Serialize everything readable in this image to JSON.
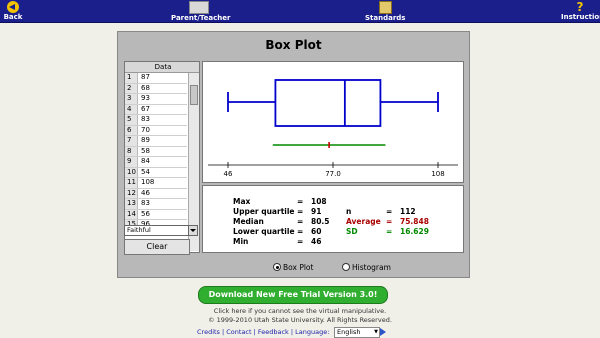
{
  "nav": {
    "back_label": "Back",
    "parent_label": "Parent/Teacher",
    "standards_label": "Standards",
    "instructions_label": "Instructions",
    "instructions_glyph": "?"
  },
  "title": "Box Plot",
  "table": {
    "header": "Data",
    "rows": [
      {
        "i": "1",
        "v": "87"
      },
      {
        "i": "2",
        "v": "68"
      },
      {
        "i": "3",
        "v": "93"
      },
      {
        "i": "4",
        "v": "67"
      },
      {
        "i": "5",
        "v": "83"
      },
      {
        "i": "6",
        "v": "70"
      },
      {
        "i": "7",
        "v": "89"
      },
      {
        "i": "8",
        "v": "58"
      },
      {
        "i": "9",
        "v": "84"
      },
      {
        "i": "10",
        "v": "54"
      },
      {
        "i": "11",
        "v": "108"
      },
      {
        "i": "12",
        "v": "46"
      },
      {
        "i": "13",
        "v": "83"
      },
      {
        "i": "14",
        "v": "56"
      },
      {
        "i": "15",
        "v": "96"
      }
    ]
  },
  "dataset_select": "Faithful",
  "clear_label": "Clear",
  "chart_data": {
    "type": "boxplot",
    "min": 46,
    "q1": 60,
    "median": 80.5,
    "q3": 91,
    "max": 108,
    "mean": 75.848,
    "sd": 16.629,
    "axis": {
      "ticks": [
        "46",
        "77.0",
        "108"
      ],
      "tick_values": [
        46,
        77.0,
        108
      ],
      "range": [
        46,
        108
      ]
    },
    "colors": {
      "box": "#0000cc",
      "mean_line": "#008800",
      "mean_marker": "#cc0000"
    }
  },
  "stats": {
    "max_label": "Max",
    "max_val": "108",
    "uq_label": "Upper quartile",
    "uq_val": "91",
    "median_label": "Median",
    "median_val": "80.5",
    "lq_label": "Lower quartile",
    "lq_val": "60",
    "min_label": "Min",
    "min_val": "46",
    "n_label": "n",
    "n_val": "112",
    "avg_label": "Average",
    "avg_val": "75.848",
    "sd_label": "SD",
    "sd_val": "16.629",
    "eq": "="
  },
  "radio": {
    "boxplot": "Box Plot",
    "histogram": "Histogram"
  },
  "download_label": "Download New Free Trial Version 3.0!",
  "footer": {
    "line1": "Click here if you cannot see the virtual manipulative.",
    "line2": "© 1999-2010 Utah State University. All Rights Reserved.",
    "links": "Credits | Contact | Feedback | Language:",
    "language": "English"
  }
}
